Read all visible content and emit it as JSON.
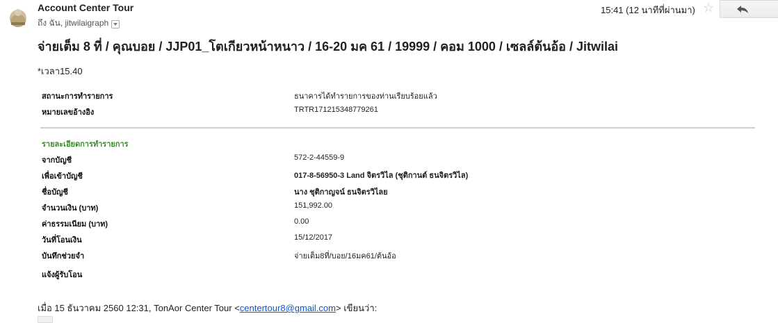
{
  "header": {
    "sender": "Account Center Tour",
    "to_line": "ถึง ฉัน, jitwilaigraph",
    "time": "15:41 (12 นาทีที่ผ่านมา)"
  },
  "subject": "จ่ายเต็ม 8 ที่ / คุณบอย / JJP01_โตเกียวหน้าหนาว / 16-20 มค 61 / 19999 / คอม 1000 / เซลล์ต้นอ้อ / Jitwilai",
  "note": "*เวลา15.40",
  "status": [
    {
      "label": "สถานะการทำรายการ",
      "value": "ธนาคารได้ทำรายการของท่านเรียบร้อยแล้ว"
    },
    {
      "label": "หมายเลขอ้างอิง",
      "value": "TRTR171215348779261"
    }
  ],
  "details_title": "รายละเอียดการทำรายการ",
  "details": [
    {
      "label": "จากบัญชี",
      "value": "572-2-44559-9"
    },
    {
      "label": "เพื่อเข้าบัญชี",
      "value": "017-8-56950-3 Land จิตรวิไล (ชุติกานต์ ธนจิตรวิไล)"
    },
    {
      "label": "ชื่อบัญชี",
      "value": "นาง ชุติกาญจน์ ธนจิตรวิไลย"
    },
    {
      "label": "จำนวนเงิน (บาท)",
      "value": "151,992.00"
    },
    {
      "label": "ค่าธรรมเนียม (บาท)",
      "value": "0.00"
    },
    {
      "label": "วันที่โอนเงิน",
      "value": "15/12/2017"
    },
    {
      "label": "บันทึกช่วยจำ",
      "value": "จ่ายเต็ม8ที่/บอย/16มค61/ต้นอ้อ"
    },
    {
      "label": "แจ้งผู้รับโอน",
      "value": ""
    }
  ],
  "quote": {
    "prefix": "เมื่อ 15 ธันวาคม 2560 12:31, TonAor Center Tour <",
    "email": "centertour8@gmail.com",
    "suffix": "> เขียนว่า:"
  },
  "icons": {
    "avatar": "sender-avatar",
    "dropdown": "chevron-down-icon",
    "star": "star-icon",
    "reply": "reply-icon"
  }
}
